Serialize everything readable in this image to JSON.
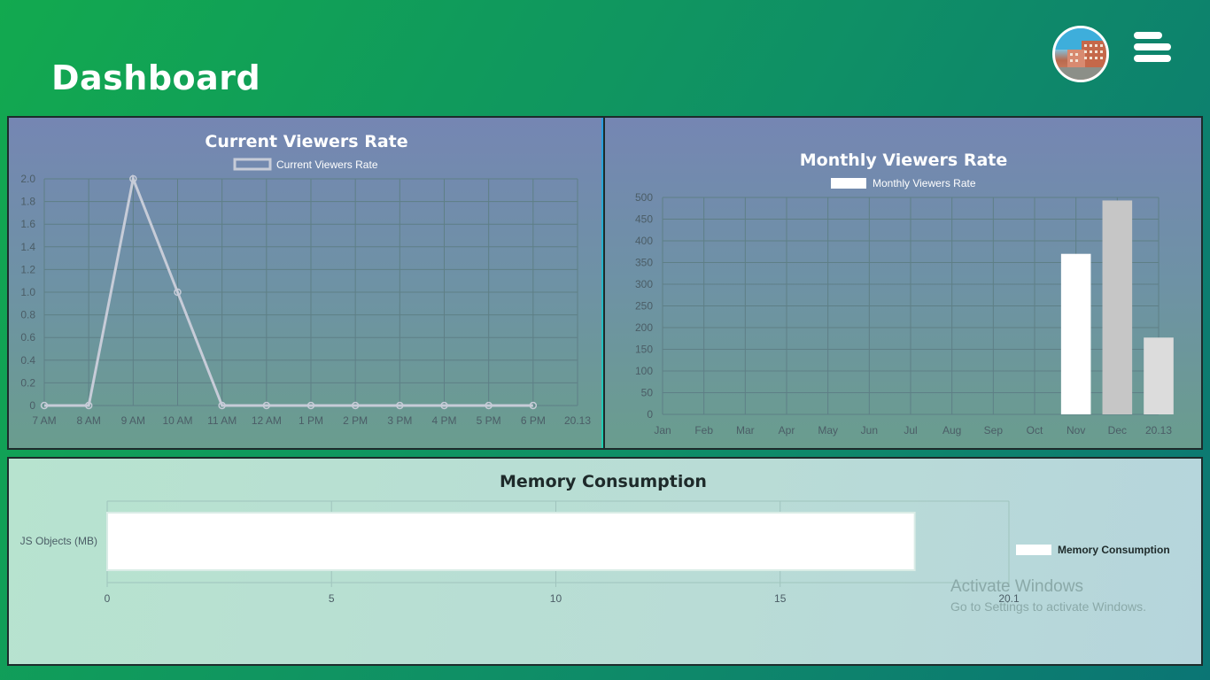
{
  "header": {
    "title": "Dashboard",
    "avatar_alt": "profile-photo",
    "menu_icon": "hamburger-icon"
  },
  "charts": [
    {
      "type": "line",
      "title": "Current Viewers Rate",
      "legend": "Current Viewers Rate",
      "categories": [
        "7 AM",
        "8 AM",
        "9 AM",
        "10 AM",
        "11 AM",
        "12 AM",
        "1 PM",
        "2 PM",
        "3 PM",
        "4 PM",
        "5 PM",
        "6 PM",
        "20.13"
      ],
      "values": [
        0,
        0,
        2,
        1,
        0,
        0,
        0,
        0,
        0,
        0,
        0,
        0
      ],
      "yticks": [
        "0",
        "0.2",
        "0.4",
        "0.6",
        "0.8",
        "1.0",
        "1.2",
        "1.4",
        "1.6",
        "1.8",
        "2.0"
      ],
      "ylim": [
        0,
        2
      ],
      "grid": true,
      "legend_position": "top",
      "line_color": "#c7ccd8"
    },
    {
      "type": "bar",
      "title": "Monthly Viewers Rate",
      "legend": "Monthly Viewers Rate",
      "categories": [
        "Jan",
        "Feb",
        "Mar",
        "Apr",
        "May",
        "Jun",
        "Jul",
        "Aug",
        "Sep",
        "Oct",
        "Nov",
        "Dec",
        "20.13"
      ],
      "values": [
        0,
        0,
        0,
        0,
        0,
        0,
        0,
        0,
        0,
        370,
        493,
        177
      ],
      "bar_colors": [
        "#ffffff",
        "#ffffff",
        "#ffffff",
        "#ffffff",
        "#ffffff",
        "#ffffff",
        "#ffffff",
        "#ffffff",
        "#ffffff",
        "#ffffff",
        "#c6c6c6",
        "#dcdcdc"
      ],
      "yticks": [
        "0",
        "50",
        "100",
        "150",
        "200",
        "250",
        "300",
        "350",
        "400",
        "450",
        "500"
      ],
      "ylim": [
        0,
        500
      ],
      "grid": true,
      "legend_position": "top"
    },
    {
      "type": "bar",
      "orientation": "horizontal",
      "title": "Memory Consumption",
      "legend": "Memory Consumption",
      "categories": [
        "JS Objects (MB)"
      ],
      "values": [
        18
      ],
      "xticks": [
        "0",
        "5",
        "10",
        "15",
        "20.1"
      ],
      "xlim": [
        0,
        20.1
      ],
      "grid": true,
      "legend_position": "right"
    }
  ],
  "watermark": {
    "line1": "Activate Windows",
    "line2": "Go to Settings to activate Windows."
  }
}
